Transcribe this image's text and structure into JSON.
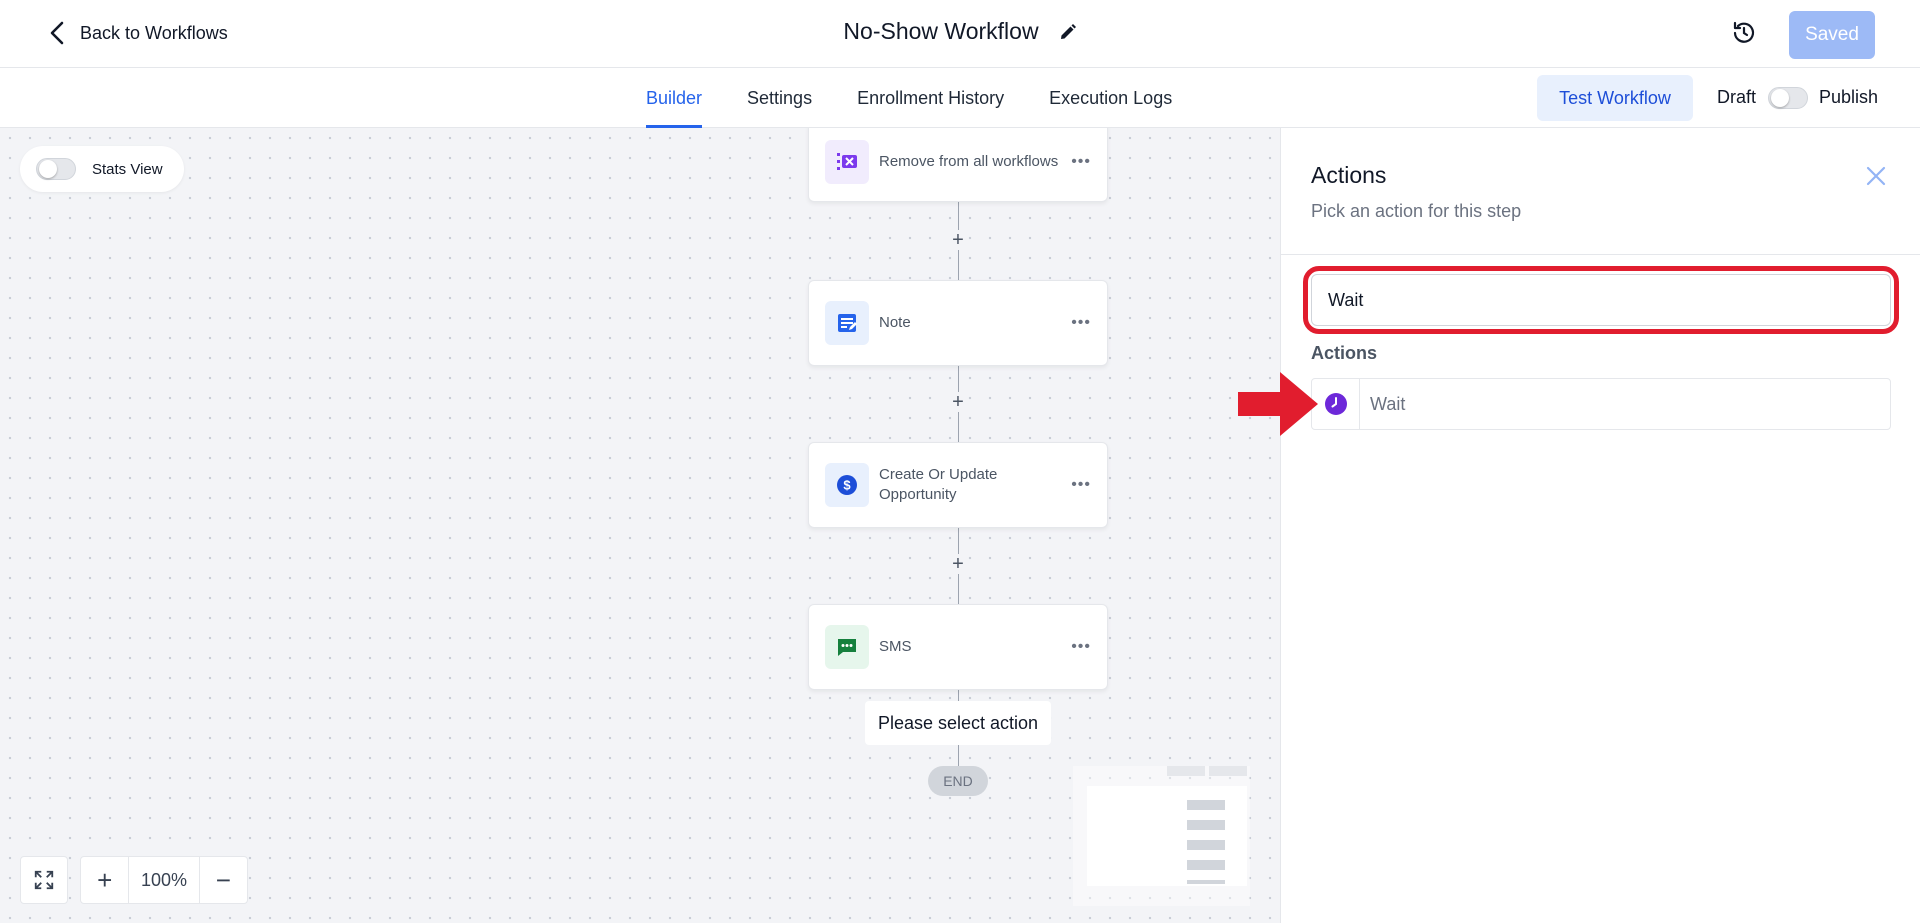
{
  "header": {
    "back_label": "Back to Workflows",
    "title": "No-Show Workflow",
    "saved_label": "Saved"
  },
  "tabs": [
    {
      "label": "Builder",
      "active": true
    },
    {
      "label": "Settings",
      "active": false
    },
    {
      "label": "Enrollment History",
      "active": false
    },
    {
      "label": "Execution Logs",
      "active": false
    }
  ],
  "toolbar": {
    "test_label": "Test Workflow",
    "draft_label": "Draft",
    "publish_label": "Publish"
  },
  "canvas": {
    "stats_label": "Stats View",
    "nodes": [
      {
        "label": "Remove from all workflows",
        "icon": "remove-workflow-icon",
        "color": "#7c3aed"
      },
      {
        "label": "Note",
        "icon": "note-icon",
        "color": "#2563eb"
      },
      {
        "label": "Create Or Update Opportunity",
        "icon": "dollar-icon",
        "color": "#1d4ed8"
      },
      {
        "label": "SMS",
        "icon": "sms-icon",
        "color": "#15803d"
      }
    ],
    "select_tip": "Please select action",
    "end_label": "END",
    "zoom_level": "100%"
  },
  "panel": {
    "title": "Actions",
    "subtitle": "Pick an action for this step",
    "search_value": "Wait",
    "section_label": "Actions",
    "results": [
      {
        "label": "Wait",
        "icon": "clock-icon",
        "color": "#6d28d9"
      }
    ]
  },
  "colors": {
    "accent": "#2563eb",
    "highlight": "#e11d2e"
  }
}
